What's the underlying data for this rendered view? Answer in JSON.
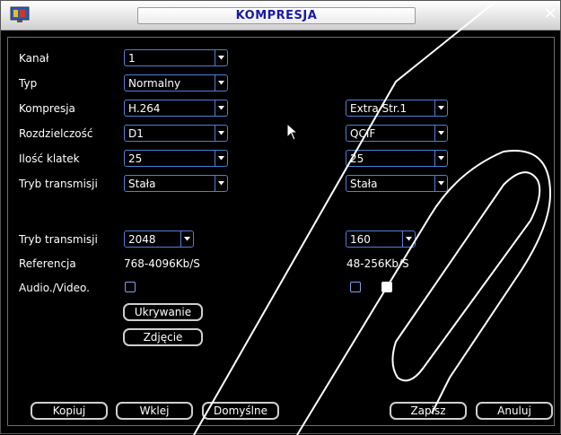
{
  "window": {
    "title": "KOMPRESJA",
    "close_glyph": "✕"
  },
  "labels": {
    "kanal": "Kanał",
    "typ": "Typ",
    "kompresja": "Kompresja",
    "rozdzielczosc": "Rozdzielczość",
    "ilosc_klatek": "Ilość klatek",
    "tryb_transmisji_1": "Tryb transmisji",
    "tryb_transmisji_2": "Tryb transmisji",
    "referencja": "Referencja",
    "audio_video": "Audio./Video."
  },
  "main_stream": {
    "kanal": "1",
    "typ": "Normalny",
    "kompresja": "H.264",
    "rozdzielczosc": "D1",
    "ilosc_klatek": "25",
    "tryb_transmisji": "Stała",
    "bitrate": "2048",
    "referencja": "768-4096Kb/S",
    "audio_video_checked": false
  },
  "extra_stream": {
    "name": "Extra Str.1",
    "rozdzielczosc": "QCIF",
    "ilosc_klatek": "25",
    "tryb_transmisji": "Stała",
    "bitrate": "160",
    "referencja": "48-256Kb/S",
    "audio_checked": false,
    "video_checked": true
  },
  "buttons": {
    "ukrywanie": "Ukrywanie",
    "zdjecie": "Zdjęcie",
    "kopiuj": "Kopiuj",
    "wklej": "Wklej",
    "domyslne": "Domyślne",
    "zapisz": "Zapisz",
    "anuluj": "Anuluj"
  },
  "colors": {
    "title_text": "#1a1aa6",
    "dropdown_border": "#4f7fd6",
    "background": "#000000",
    "text": "#ffffff"
  }
}
